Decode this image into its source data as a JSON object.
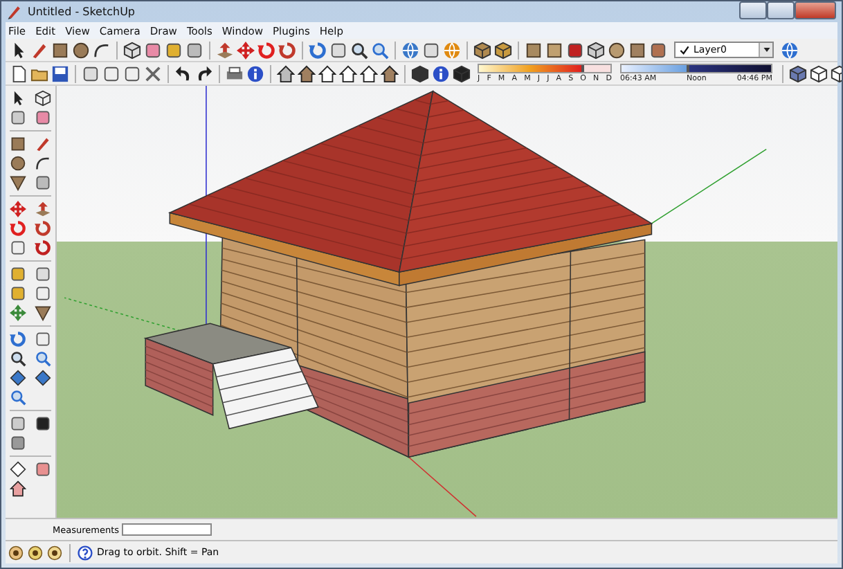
{
  "window": {
    "title": "Untitled - SketchUp"
  },
  "menu": [
    "File",
    "Edit",
    "View",
    "Camera",
    "Draw",
    "Tools",
    "Window",
    "Plugins",
    "Help"
  ],
  "layer_dropdown": {
    "value": "Layer0"
  },
  "shadow_settings": {
    "date_slider": {
      "level": 0.8
    },
    "time_slider": {
      "level": 0.45
    },
    "months": [
      "J",
      "F",
      "M",
      "A",
      "M",
      "J",
      "J",
      "A",
      "S",
      "O",
      "N",
      "D"
    ],
    "time_start": "06:43 AM",
    "time_mid": "Noon",
    "time_end": "04:46 PM"
  },
  "measurements": {
    "label": "Measurements"
  },
  "status_bar": {
    "hint": "Drag to orbit. Shift = Pan"
  }
}
